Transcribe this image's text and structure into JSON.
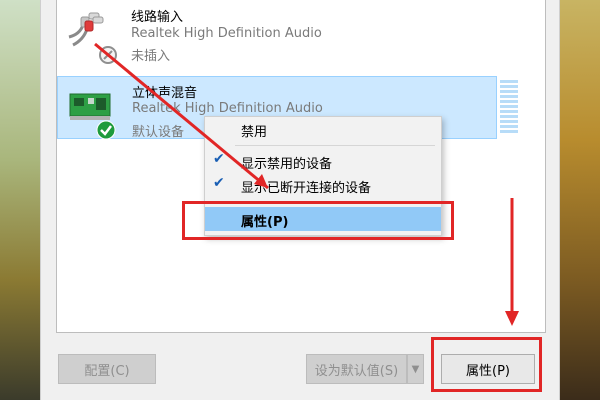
{
  "devices": [
    {
      "name": "线路输入",
      "driver": "Realtek High Definition Audio",
      "status": "未插入",
      "icon": "audio-cable-icon",
      "state_icon": "unplugged-icon",
      "selected": false
    },
    {
      "name": "立体声混音",
      "driver": "Realtek High Definition Audio",
      "status": "默认设备",
      "icon": "sound-card-icon",
      "state_icon": "default-device-check-icon",
      "selected": true
    }
  ],
  "context_menu": {
    "items": [
      {
        "label": "禁用",
        "checked": false,
        "highlighted": false
      },
      {
        "label": "显示禁用的设备",
        "checked": true,
        "highlighted": false
      },
      {
        "label": "显示已断开连接的设备",
        "checked": true,
        "highlighted": false
      },
      {
        "label": "属性(P)",
        "checked": false,
        "highlighted": true
      }
    ]
  },
  "buttons": {
    "configure": "配置(C)",
    "set_default": "设为默认值(S)",
    "properties": "属性(P)"
  },
  "colors": {
    "selection": "#cce8ff",
    "menu_highlight": "#91c9f7",
    "annotation_red": "#e12626",
    "check_blue": "#1a5fb4"
  }
}
